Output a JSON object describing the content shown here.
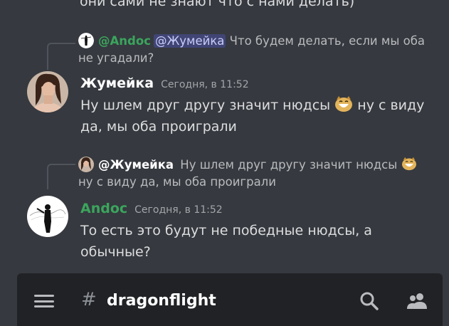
{
  "top_cut_text": "они сами не знают что с нами делать)",
  "messages": [
    {
      "reply": {
        "author": "@Andoc",
        "mention": "@Жумейка",
        "text": "Что будем делать, если мы оба не угадали?"
      },
      "author": "Жумейка",
      "timestamp": "Сегодня, в 11:52",
      "line1_a": "Ну шлем друг другу значит нюдсы",
      "line1_b": "ну с виду",
      "line2": "да, мы оба проиграли",
      "author_color": "#ffffff"
    },
    {
      "reply": {
        "author": "@Жумейка",
        "text_a": "Ну шлем друг другу значит нюдсы",
        "text_b": "ну",
        "text_c": "с виду да, мы оба проиграли"
      },
      "author": "Andoc",
      "timestamp": "Сегодня, в 11:52",
      "text": "То есть это будут не победные нюдсы, а обычные?",
      "author_color": "#3ba55d"
    }
  ],
  "header": {
    "hash": "#",
    "channel": "dragonflight",
    "icons": [
      "menu-icon",
      "search-icon",
      "members-icon"
    ]
  },
  "colors": {
    "background": "#36393f",
    "header": "#202225",
    "green": "#3ba55d",
    "mention_bg": "#5865f2"
  }
}
